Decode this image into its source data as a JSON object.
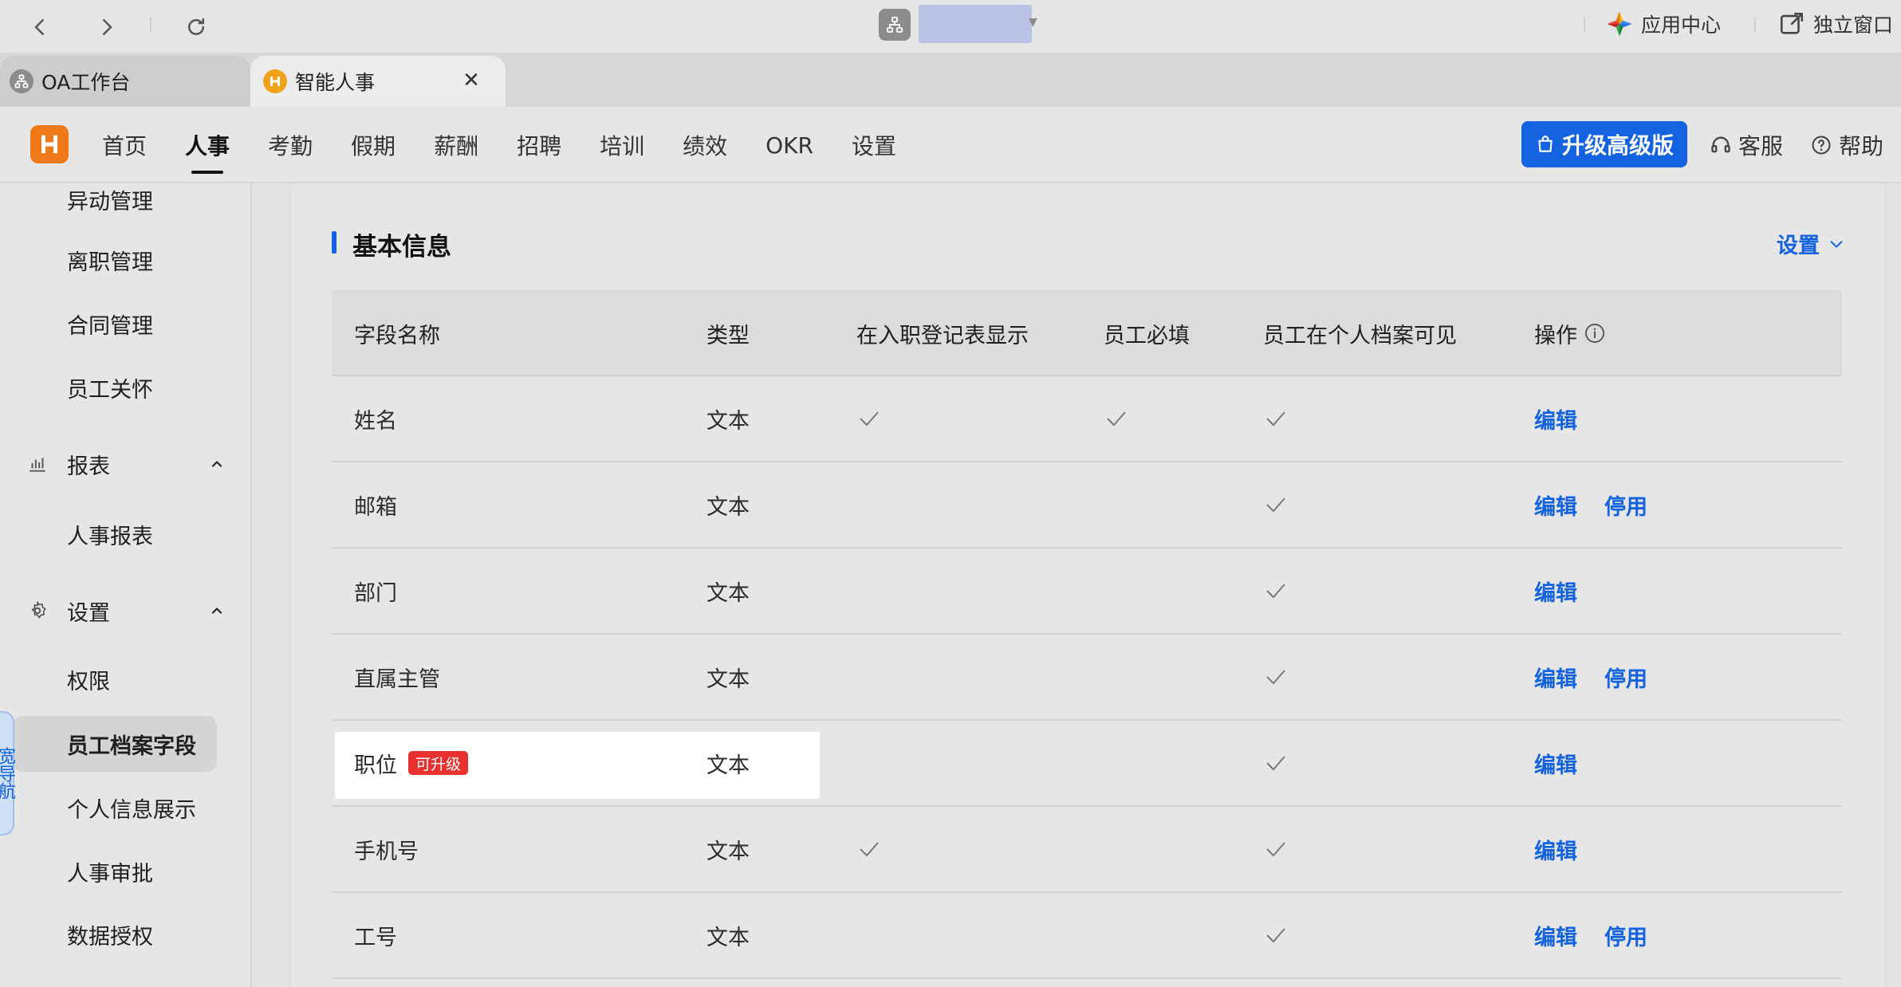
{
  "browser": {
    "app_center_label": "应用中心",
    "standalone_label": "独立窗口"
  },
  "tabs": [
    {
      "label": "OA工作台",
      "active": false
    },
    {
      "label": "智能人事",
      "active": true
    }
  ],
  "header": {
    "nav": [
      "首页",
      "人事",
      "考勤",
      "假期",
      "薪酬",
      "招聘",
      "培训",
      "绩效",
      "OKR",
      "设置"
    ],
    "active_nav": "人事",
    "upgrade_label": "升级高级版",
    "service_label": "客服",
    "help_label": "帮助"
  },
  "sidebar": {
    "top_items": [
      "异动管理",
      "离职管理",
      "合同管理",
      "员工关怀"
    ],
    "report_group": "报表",
    "report_items": [
      "人事报表"
    ],
    "settings_group": "设置",
    "settings_items": [
      "权限",
      "员工档案字段",
      "个人信息展示",
      "人事审批",
      "数据授权"
    ],
    "active_item": "员工档案字段",
    "guide_tab_text": "宽导航"
  },
  "section": {
    "title": "基本信息",
    "settings_label": "设置"
  },
  "table": {
    "columns": [
      "字段名称",
      "类型",
      "在入职登记表显示",
      "员工必填",
      "员工在个人档案可见",
      "操作"
    ],
    "edit_label": "编辑",
    "disable_label": "停用",
    "rows": [
      {
        "name": "姓名",
        "type": "文本",
        "entry_form": true,
        "required": true,
        "visible": true,
        "can_disable": false,
        "badge": ""
      },
      {
        "name": "邮箱",
        "type": "文本",
        "entry_form": false,
        "required": false,
        "visible": true,
        "can_disable": true,
        "badge": ""
      },
      {
        "name": "部门",
        "type": "文本",
        "entry_form": false,
        "required": false,
        "visible": true,
        "can_disable": false,
        "badge": ""
      },
      {
        "name": "直属主管",
        "type": "文本",
        "entry_form": false,
        "required": false,
        "visible": true,
        "can_disable": true,
        "badge": ""
      },
      {
        "name": "职位",
        "type": "文本",
        "entry_form": false,
        "required": false,
        "visible": true,
        "can_disable": false,
        "badge": "可升级",
        "highlighted": true
      },
      {
        "name": "手机号",
        "type": "文本",
        "entry_form": true,
        "required": false,
        "visible": true,
        "can_disable": false,
        "badge": ""
      },
      {
        "name": "工号",
        "type": "文本",
        "entry_form": false,
        "required": false,
        "visible": true,
        "can_disable": true,
        "badge": ""
      }
    ]
  },
  "colors": {
    "accent": "#1363e0",
    "logo": "#f07a1a",
    "badge": "#e8312f"
  }
}
